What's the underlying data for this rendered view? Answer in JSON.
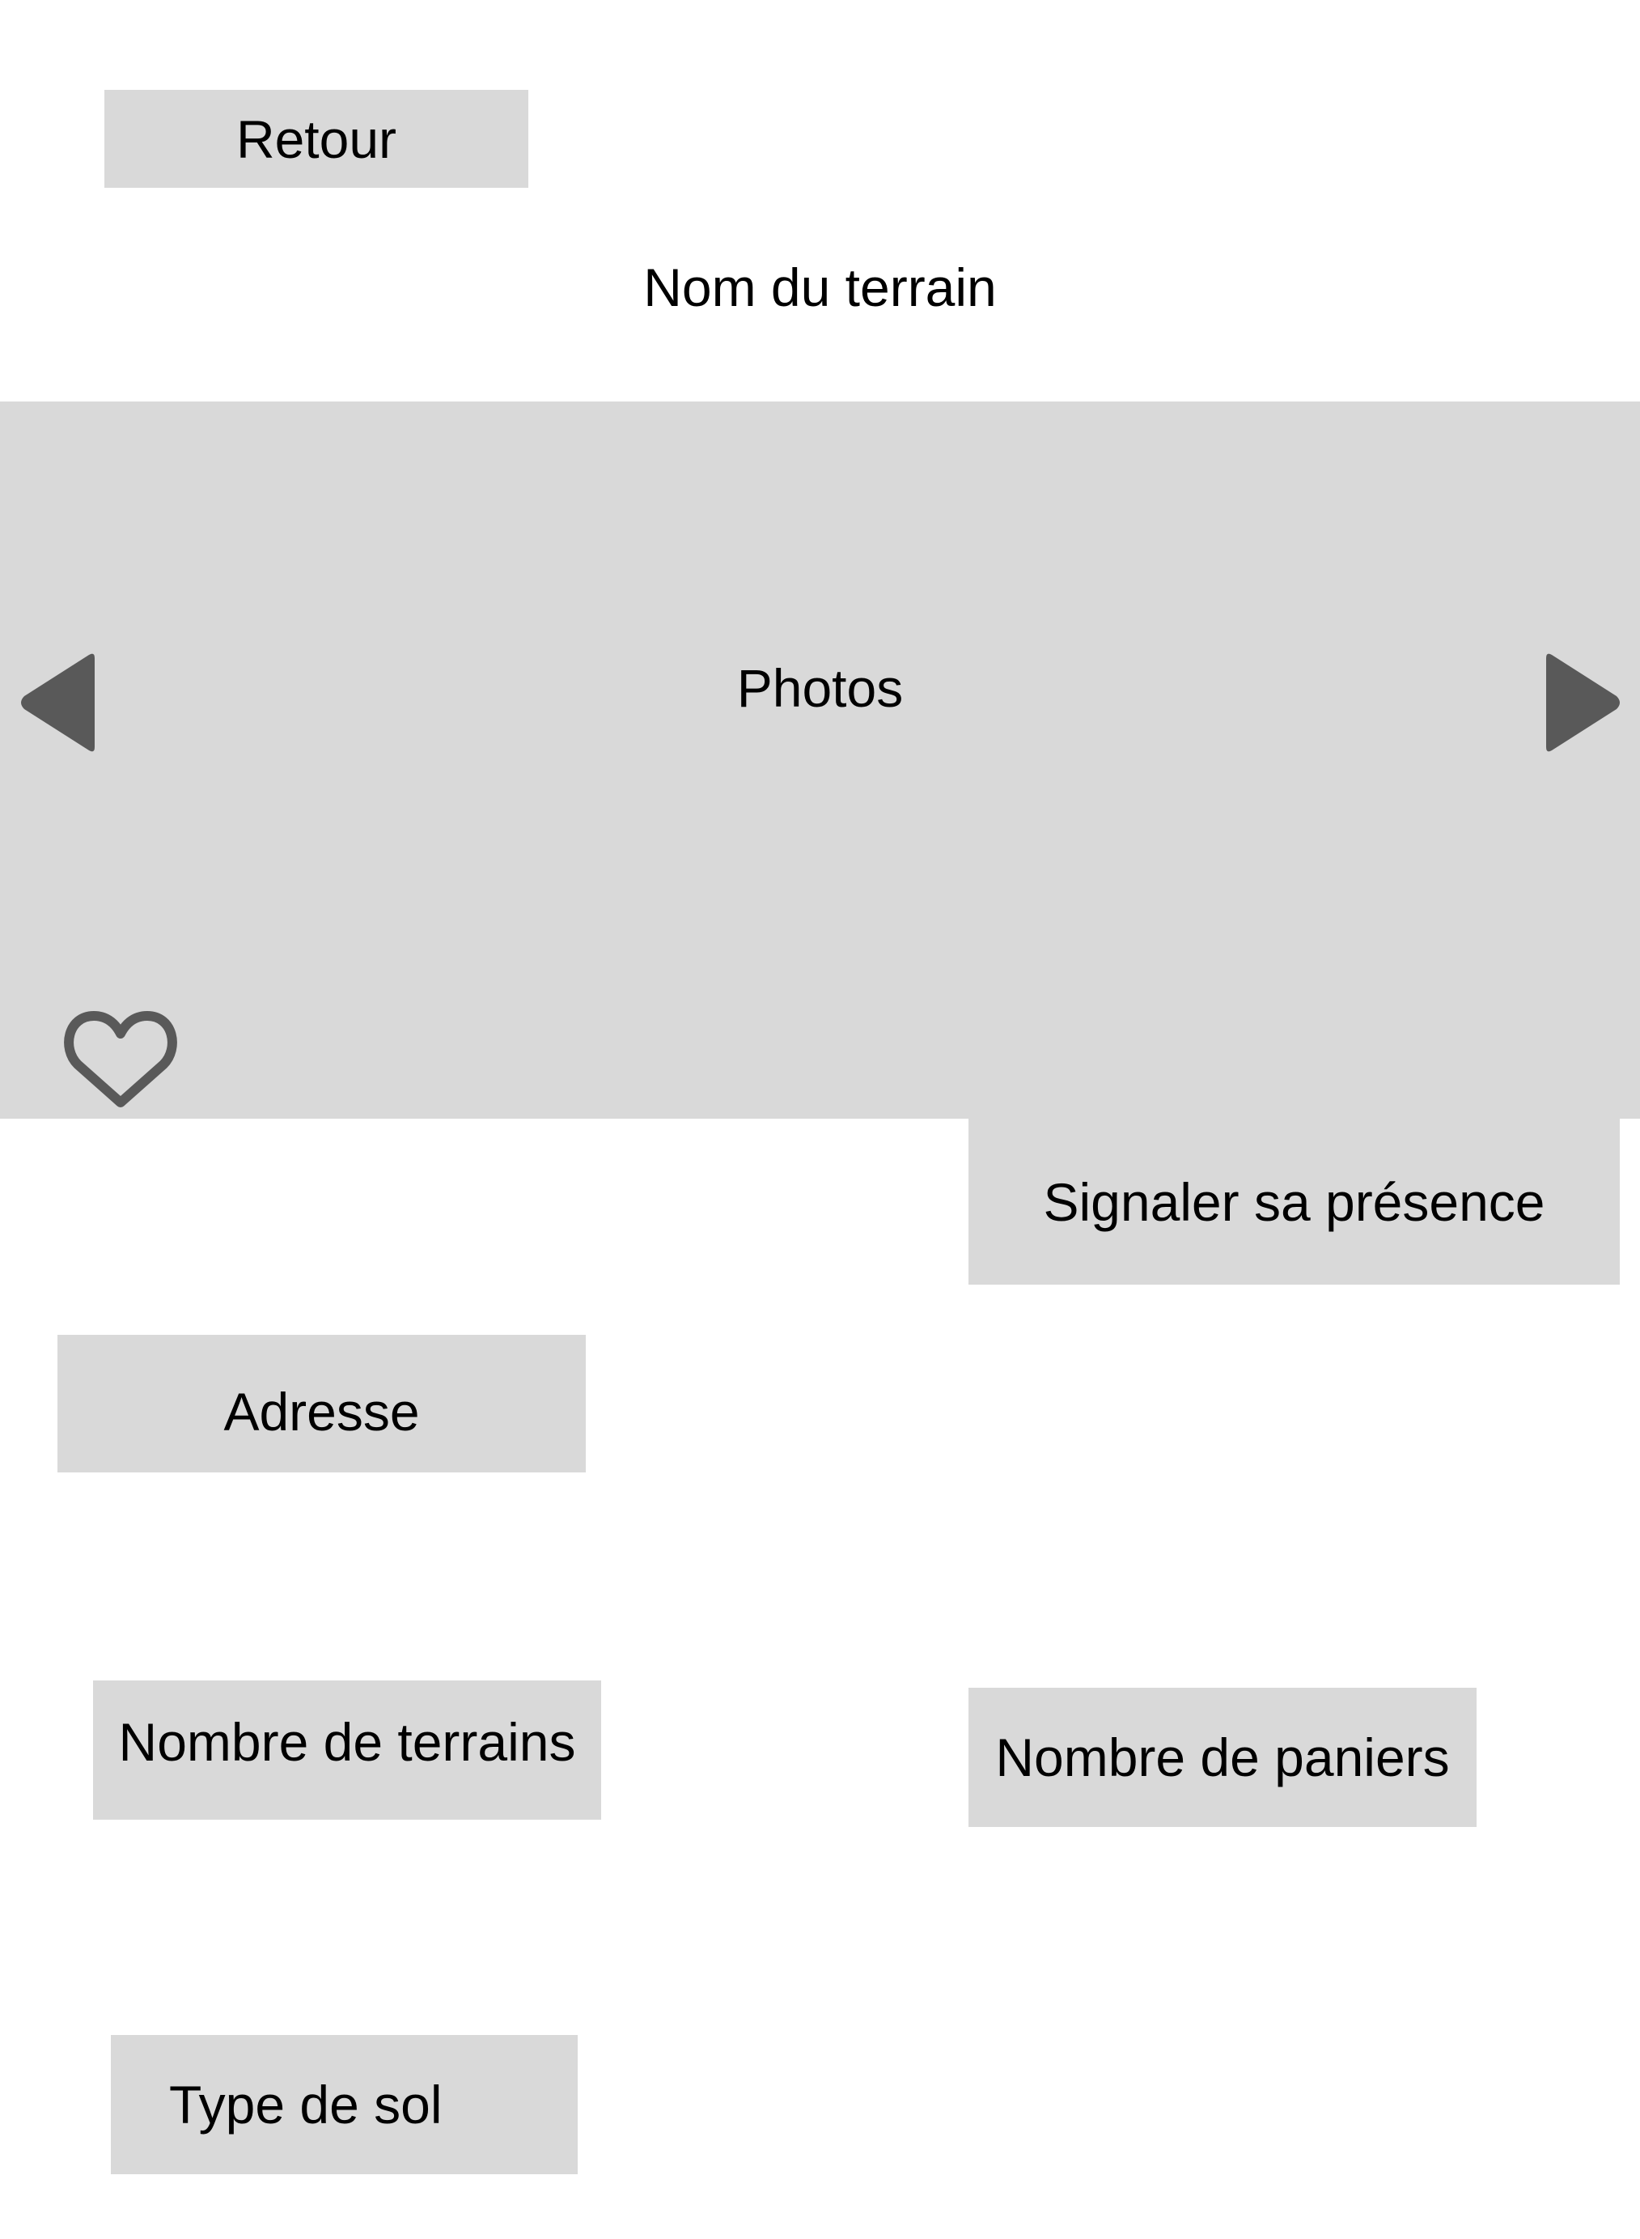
{
  "header": {
    "back_label": "Retour",
    "title": "Nom du terrain"
  },
  "gallery": {
    "label": "Photos",
    "prev_icon": "arrow-left-icon",
    "next_icon": "arrow-right-icon",
    "favorite_icon": "heart-outline-icon"
  },
  "actions": {
    "check_in_label": "Signaler sa présence"
  },
  "details": {
    "address_label": "Adresse",
    "courts_count_label": "Nombre de terrains",
    "baskets_count_label": "Nombre de paniers",
    "surface_type_label": "Type de sol"
  },
  "colors": {
    "placeholder_gray": "#d9d9d9",
    "icon_gray": "#595959",
    "text": "#000000",
    "background": "#ffffff"
  }
}
